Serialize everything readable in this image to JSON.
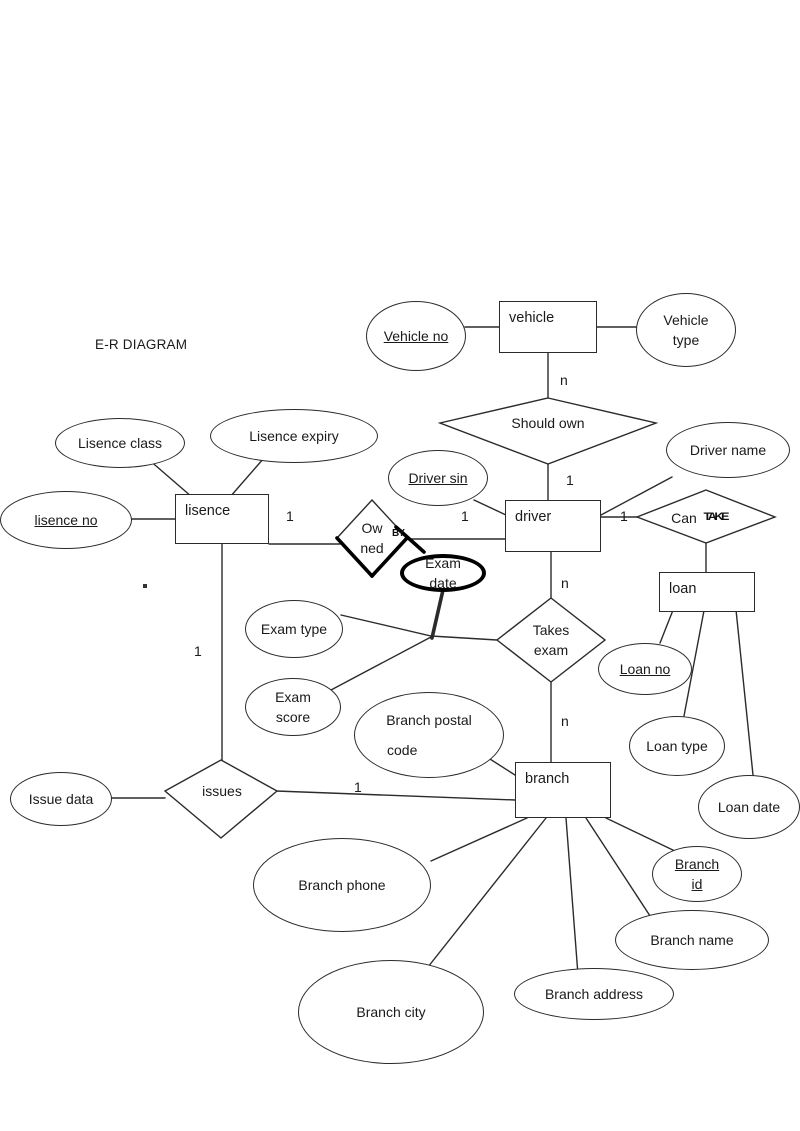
{
  "diagram": {
    "title": "E-R DIAGRAM",
    "type": "entity-relationship",
    "stroke_color": "#2b2b2b",
    "background": "#ffffff",
    "entities": [
      {
        "id": "vehicle",
        "label": "vehicle"
      },
      {
        "id": "driver",
        "label": "driver"
      },
      {
        "id": "lisence",
        "label": "lisence"
      },
      {
        "id": "loan",
        "label": "loan"
      },
      {
        "id": "branch",
        "label": "branch"
      }
    ],
    "relationships": [
      {
        "id": "should-own",
        "label": "Should own",
        "lines": [
          "Should own"
        ]
      },
      {
        "id": "owned-by",
        "label": "Owned BY",
        "lines": [
          "Ow",
          "ned"
        ],
        "extra": "BY",
        "bold_edges": true
      },
      {
        "id": "can-take",
        "label": "Can TAKE",
        "lines": [
          "Can"
        ],
        "extra": "TAKE"
      },
      {
        "id": "takes-exam",
        "label": "Takes exam",
        "lines": [
          "Takes",
          "exam"
        ]
      },
      {
        "id": "issues",
        "label": "issues",
        "lines": [
          "issues"
        ]
      }
    ],
    "attributes": [
      {
        "id": "vehicle-no",
        "lines": [
          "Vehicle no"
        ],
        "key": true,
        "owner": "vehicle"
      },
      {
        "id": "vehicle-type",
        "lines": [
          "Vehicle",
          "type"
        ],
        "key": false,
        "owner": "vehicle"
      },
      {
        "id": "driver-sin",
        "lines": [
          "Driver sin"
        ],
        "key": true,
        "owner": "driver"
      },
      {
        "id": "driver-name",
        "lines": [
          "Driver name"
        ],
        "key": false,
        "owner": "driver"
      },
      {
        "id": "lisence-no",
        "lines": [
          "lisence no"
        ],
        "key": true,
        "owner": "lisence"
      },
      {
        "id": "lisence-class",
        "lines": [
          "Lisence class"
        ],
        "key": false,
        "owner": "lisence"
      },
      {
        "id": "lisence-expiry",
        "lines": [
          "Lisence expiry"
        ],
        "key": false,
        "owner": "lisence"
      },
      {
        "id": "exam-date",
        "lines": [
          "Exam date"
        ],
        "key": false,
        "owner": "takes-exam",
        "bold": true
      },
      {
        "id": "exam-type",
        "lines": [
          "Exam type"
        ],
        "key": false,
        "owner": "takes-exam"
      },
      {
        "id": "exam-score",
        "lines": [
          "Exam",
          "score"
        ],
        "key": false,
        "owner": "takes-exam"
      },
      {
        "id": "loan-no",
        "lines": [
          "Loan no"
        ],
        "key": true,
        "owner": "loan"
      },
      {
        "id": "loan-type",
        "lines": [
          "Loan type"
        ],
        "key": false,
        "owner": "loan"
      },
      {
        "id": "loan-date",
        "lines": [
          "Loan date"
        ],
        "key": false,
        "owner": "loan"
      },
      {
        "id": "branch-id",
        "lines": [
          "Branch ",
          "id"
        ],
        "key": true,
        "owner": "branch"
      },
      {
        "id": "branch-name",
        "lines": [
          "Branch name"
        ],
        "key": false,
        "owner": "branch"
      },
      {
        "id": "branch-address",
        "lines": [
          "Branch address"
        ],
        "key": false,
        "owner": "branch"
      },
      {
        "id": "branch-city",
        "lines": [
          "Branch city"
        ],
        "key": false,
        "owner": "branch"
      },
      {
        "id": "branch-phone",
        "lines": [
          "Branch phone"
        ],
        "key": false,
        "owner": "branch"
      },
      {
        "id": "branch-postal",
        "lines": [
          "Branch postal",
          "code"
        ],
        "key": false,
        "owner": "branch"
      },
      {
        "id": "issue-data",
        "lines": [
          "Issue data"
        ],
        "key": false,
        "owner": "issues"
      }
    ],
    "cardinalities": [
      {
        "id": "card-vehicle-shouldown",
        "value": "n"
      },
      {
        "id": "card-shouldown-driver",
        "value": "1"
      },
      {
        "id": "card-lisence-ownedby",
        "value": "1"
      },
      {
        "id": "card-ownedby-driver",
        "value": "1"
      },
      {
        "id": "card-driver-cantake",
        "value": "1"
      },
      {
        "id": "card-driver-takesexam",
        "value": "n"
      },
      {
        "id": "card-takesexam-branch",
        "value": "n"
      },
      {
        "id": "card-lisence-issues",
        "value": "1"
      },
      {
        "id": "card-issues-branch",
        "value": "1"
      }
    ]
  }
}
